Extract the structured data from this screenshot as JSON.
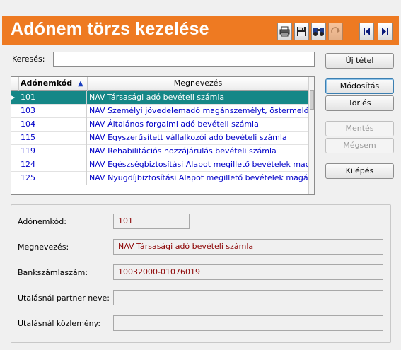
{
  "window": {
    "title": "Adónem törzs kezelése"
  },
  "toolbar": {
    "icons": [
      "printer-icon",
      "save-icon",
      "binoculars-icon",
      "redo-icon",
      "first-record-icon",
      "last-record-icon"
    ]
  },
  "search": {
    "label": "Keresés:",
    "value": ""
  },
  "buttons": {
    "new": "Új tétel",
    "edit": "Módosítás",
    "delete": "Törlés",
    "save": "Mentés",
    "cancel": "Mégsem",
    "exit": "Kilépés"
  },
  "grid": {
    "columns": [
      "Adónemkód",
      "Megnevezés"
    ],
    "sort_indicator": "▲",
    "current_row_marker": "▸",
    "rows": [
      {
        "code": "101",
        "name": "NAV Társasági adó bevételi számla",
        "selected": true
      },
      {
        "code": "103",
        "name": "NAV Személyi jövedelemadó magánszemélyt, östermelő",
        "selected": false
      },
      {
        "code": "104",
        "name": "NAV Általános forgalmi adó bevételi számla",
        "selected": false
      },
      {
        "code": "115",
        "name": "NAV Egyszerűsített vállalkozói adó bevételi számla",
        "selected": false
      },
      {
        "code": "119",
        "name": "NAV Rehabilitációs hozzájárulás bevételi számla",
        "selected": false
      },
      {
        "code": "124",
        "name": "NAV Egészségbiztosítási Alapot megillető bevételek magánszem",
        "selected": false
      },
      {
        "code": "125",
        "name": "NAV Nyugdíjbiztosítási Alapot megillető bevételek magánszem",
        "selected": false
      }
    ]
  },
  "details": {
    "code_label": "Adónemkód:",
    "code_value": "101",
    "name_label": "Megnevezés:",
    "name_value": "NAV Társasági adó bevételi számla",
    "bank_label": "Bankszámlaszám:",
    "bank_value": "10032000-01076019",
    "partner_label": "Utalásnál partner neve:",
    "partner_value": "",
    "note_label": "Utalásnál közlemény:",
    "note_value": ""
  },
  "colors": {
    "titlebar": "#ee7a22",
    "selected_row": "#158787",
    "grid_text": "#0000c8",
    "readonly_text": "#8b0000"
  }
}
